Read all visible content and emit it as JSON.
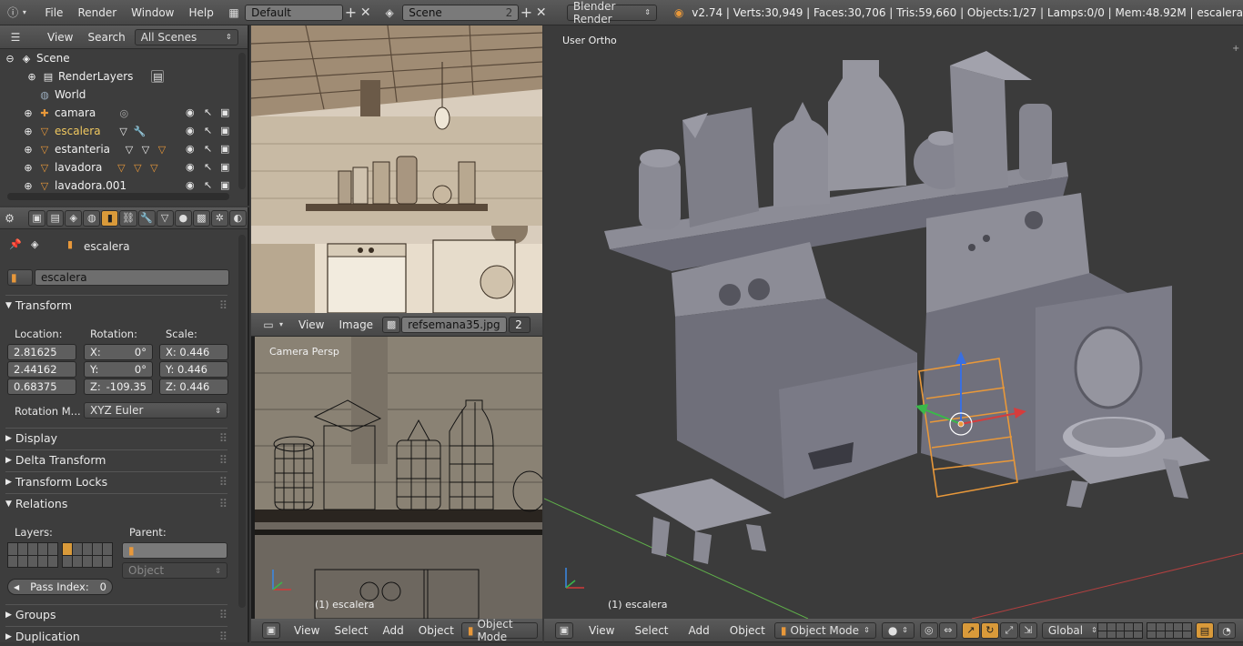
{
  "topbar": {
    "menus": [
      "File",
      "Render",
      "Window",
      "Help"
    ],
    "screen_layout": "Default",
    "scene": "Scene",
    "scene_users": "2",
    "engine": "Blender Render",
    "stats": "v2.74 | Verts:30,949 | Faces:30,706 | Tris:59,660 | Objects:1/27 | Lamps:0/0 | Mem:48.92M | escalera"
  },
  "outliner": {
    "menu_view": "View",
    "menu_search": "Search",
    "filter": "All Scenes",
    "items": [
      {
        "label": "Scene",
        "icon": "scene-icon"
      },
      {
        "label": "RenderLayers",
        "icon": "render-layers-icon"
      },
      {
        "label": "World",
        "icon": "world-icon"
      },
      {
        "label": "camara",
        "icon": "camera-icon"
      },
      {
        "label": "escalera",
        "icon": "mesh-icon"
      },
      {
        "label": "estanteria",
        "icon": "mesh-icon"
      },
      {
        "label": "lavadora",
        "icon": "mesh-icon"
      },
      {
        "label": "lavadora.001",
        "icon": "mesh-icon"
      }
    ]
  },
  "properties": {
    "context_object": "escalera",
    "object_name": "escalera",
    "transform_title": "Transform",
    "location_label": "Location:",
    "rotation_label": "Rotation:",
    "scale_label": "Scale:",
    "location": [
      "2.81625",
      "2.44162",
      "0.68375"
    ],
    "rotation": [
      {
        "axis": "X:",
        "value": "0°"
      },
      {
        "axis": "Y:",
        "value": "0°"
      },
      {
        "axis": "Z:",
        "value": "-109.35"
      }
    ],
    "scale": [
      "X: 0.446",
      "Y: 0.446",
      "Z: 0.446"
    ],
    "rotation_mode_label": "Rotation M...",
    "rotation_mode": "XYZ Euler",
    "panels": {
      "display": "Display",
      "delta": "Delta Transform",
      "locks": "Transform Locks",
      "relations": "Relations",
      "groups": "Groups",
      "duplication": "Duplication"
    },
    "layers_label": "Layers:",
    "parent_label": "Parent:",
    "parent_type": "Object",
    "pass_index_label": "Pass Index:",
    "pass_index": "0"
  },
  "image_editor": {
    "menu_view": "View",
    "menu_image": "Image",
    "image_name": "refsemana35.jpg",
    "users": "2"
  },
  "camera_view": {
    "label": "Camera Persp",
    "object_label": "(1) escalera",
    "menus": [
      "View",
      "Select",
      "Add",
      "Object"
    ],
    "mode": "Object Mode"
  },
  "main_view": {
    "label": "User Ortho",
    "object_label": "(1) escalera",
    "menus": [
      "View",
      "Select",
      "Add",
      "Object"
    ],
    "mode": "Object Mode",
    "orientation": "Global"
  },
  "colors": {
    "accent_orange": "#e8983a",
    "viewport_bg": "#393939",
    "selected_text": "#f0c860"
  }
}
